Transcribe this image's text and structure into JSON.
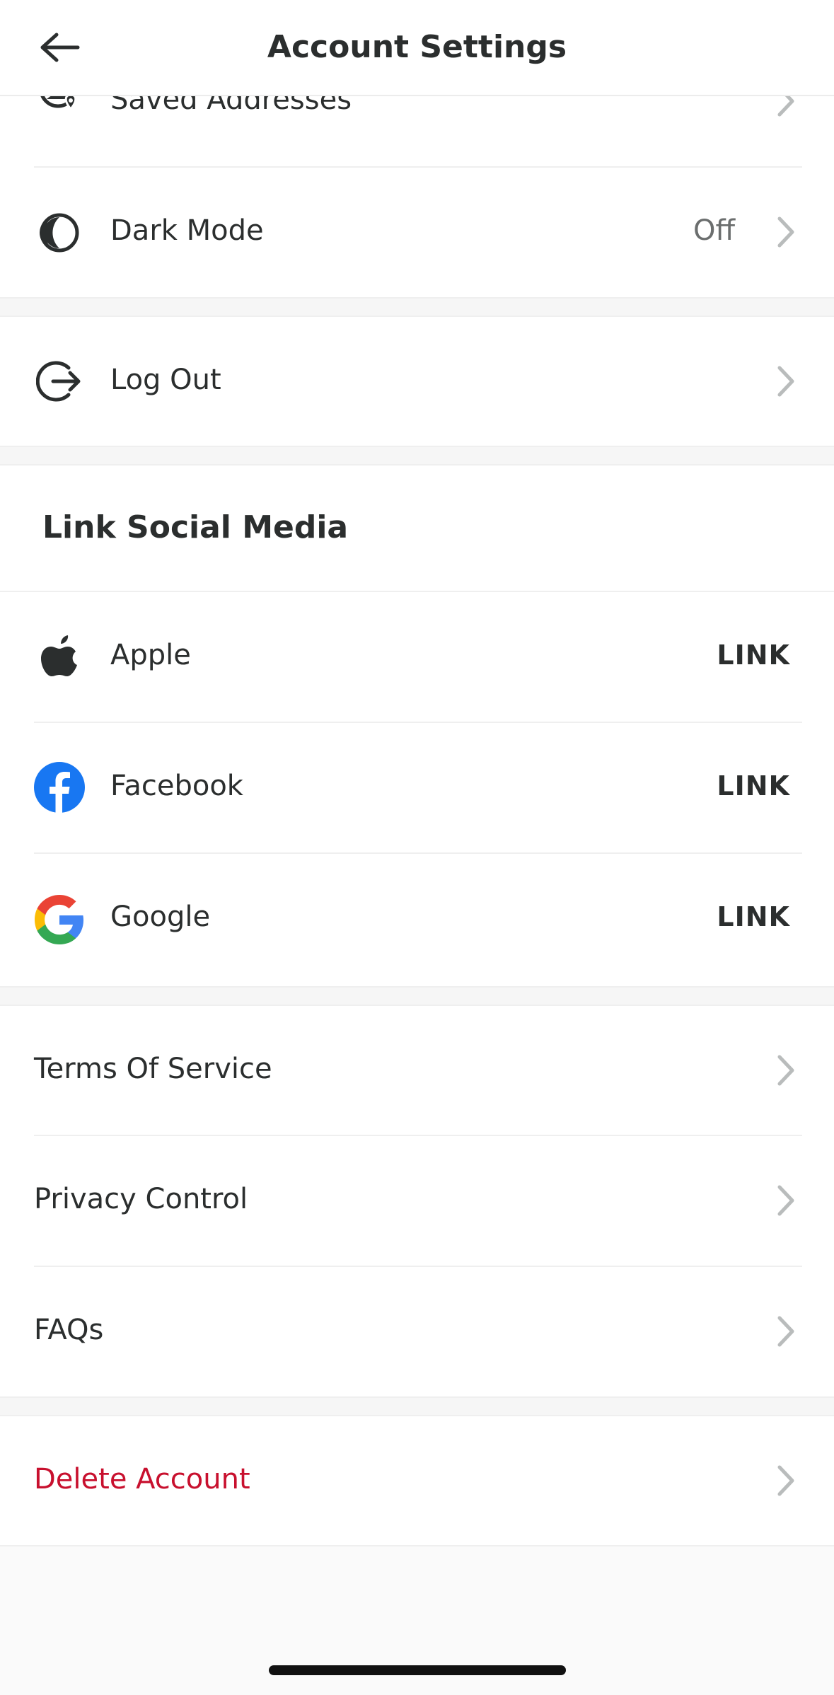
{
  "header": {
    "title": "Account Settings",
    "back_icon": "arrow-left-icon"
  },
  "account_section": {
    "items": [
      {
        "label": "Saved Addresses",
        "icon": "location-user-icon"
      },
      {
        "label": "Dark Mode",
        "value": "Off",
        "icon": "moon-icon"
      }
    ]
  },
  "logout_section": {
    "label": "Log Out",
    "icon": "logout-icon"
  },
  "social": {
    "title": "Link Social Media",
    "items": [
      {
        "label": "Apple",
        "action": "LINK",
        "icon": "apple-icon"
      },
      {
        "label": "Facebook",
        "action": "LINK",
        "icon": "facebook-icon"
      },
      {
        "label": "Google",
        "action": "LINK",
        "icon": "google-icon"
      }
    ]
  },
  "legal_section": {
    "items": [
      {
        "label": "Terms Of Service"
      },
      {
        "label": "Privacy Control"
      },
      {
        "label": "FAQs"
      }
    ]
  },
  "danger_section": {
    "label": "Delete Account",
    "color": "#c8102e"
  },
  "colors": {
    "text": "#2b2e2e",
    "danger": "#c8102e",
    "facebook": "#1877f2",
    "chevron": "#b9bcbc"
  }
}
